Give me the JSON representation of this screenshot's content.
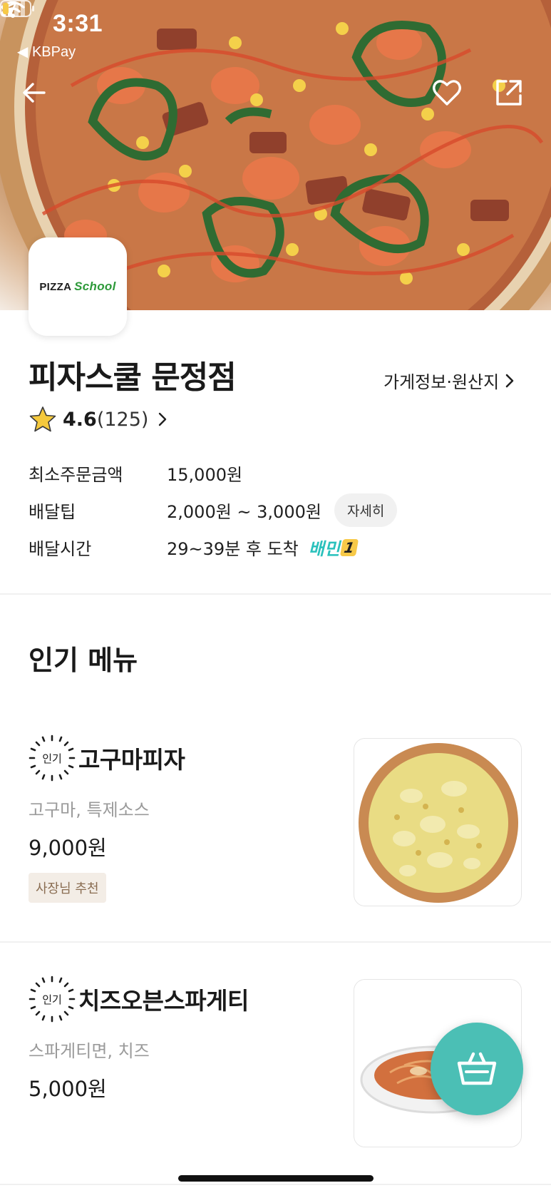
{
  "status_bar": {
    "time": "3:31",
    "back_app": "◀ KBPay"
  },
  "nav": {
    "back_icon": "arrow-left-icon",
    "favorite_icon": "heart-icon",
    "share_icon": "share-icon"
  },
  "store": {
    "logo_text_1": "PIZZA",
    "logo_text_2": "School",
    "name": "피자스쿨 문정점",
    "info_link": "가게정보·원산지",
    "rating_score": "4.6",
    "rating_count": "(125)",
    "rows": {
      "min_order_label": "최소주문금액",
      "min_order_value": "15,000원",
      "delivery_tip_label": "배달팁",
      "delivery_tip_value": "2,000원 ~ 3,000원",
      "delivery_tip_button": "자세히",
      "delivery_time_label": "배달시간",
      "delivery_time_value": "29~39분 후 도착",
      "baemin_label": "배민",
      "baemin_num": "1"
    }
  },
  "popular": {
    "title": "인기 메뉴",
    "items": [
      {
        "badge": "인기",
        "name": "고구마피자",
        "desc": "고구마, 특제소스",
        "price": "9,000원",
        "tag": "사장님 추천"
      },
      {
        "badge": "인기",
        "name": "치즈오븐스파게티",
        "desc": "스파게티면, 치즈",
        "price": "5,000원"
      }
    ]
  },
  "cart": {
    "icon": "basket-icon",
    "color": "#4bbfb5"
  },
  "colors": {
    "accent": "#2ac1bc",
    "tag_bg": "#f3ede6",
    "tag_text": "#8a6d52"
  }
}
